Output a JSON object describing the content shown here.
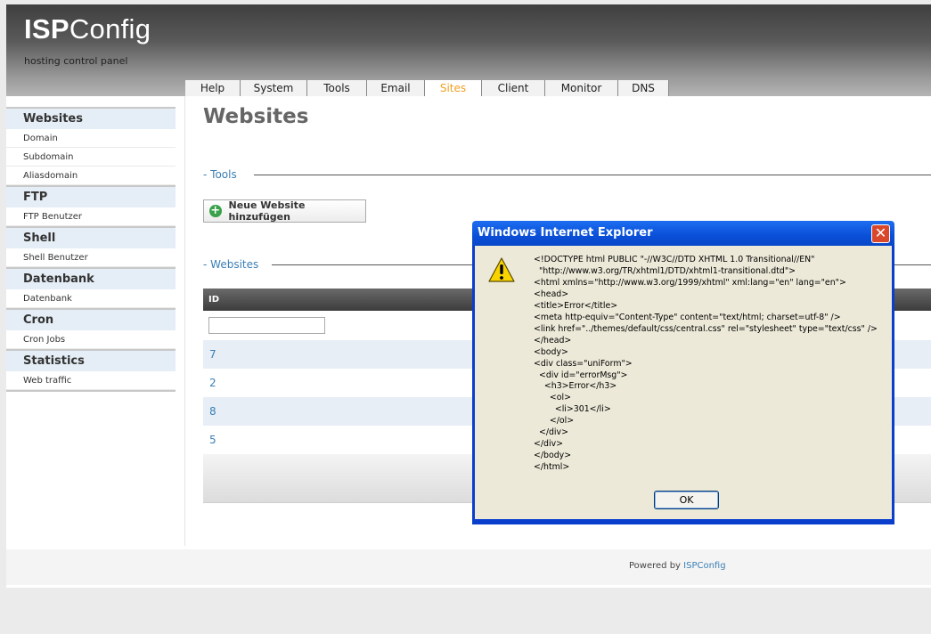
{
  "header": {
    "logo_isp": "ISP",
    "logo_config": "Config",
    "tagline": "hosting control panel",
    "tabs": [
      {
        "label": "Help"
      },
      {
        "label": "System"
      },
      {
        "label": "Tools"
      },
      {
        "label": "Email"
      },
      {
        "label": "Sites",
        "active": true
      },
      {
        "label": "Client"
      },
      {
        "label": "Monitor"
      },
      {
        "label": "DNS"
      }
    ]
  },
  "sidebar": {
    "groups": [
      {
        "title": "Websites",
        "items": [
          "Domain",
          "Subdomain",
          "Aliasdomain"
        ]
      },
      {
        "title": "FTP",
        "items": [
          "FTP Benutzer"
        ]
      },
      {
        "title": "Shell",
        "items": [
          "Shell Benutzer"
        ]
      },
      {
        "title": "Datenbank",
        "items": [
          "Datenbank"
        ]
      },
      {
        "title": "Cron",
        "items": [
          "Cron Jobs"
        ]
      },
      {
        "title": "Statistics",
        "items": [
          "Web traffic"
        ]
      }
    ]
  },
  "main": {
    "title": "Websites",
    "tools_legend": "Tools",
    "add_button": "Neue Website hinzufügen",
    "websites_legend": "Websites",
    "table": {
      "header_id": "ID",
      "filter_value": "",
      "rows": [
        "7",
        "2",
        "8",
        "5"
      ]
    }
  },
  "footer": {
    "text": "Powered by",
    "link": "ISPConfig"
  },
  "dialog": {
    "title": "Windows Internet Explorer",
    "message": "<!DOCTYPE html PUBLIC \"-//W3C//DTD XHTML 1.0 Transitional//EN\"\n  \"http://www.w3.org/TR/xhtml1/DTD/xhtml1-transitional.dtd\">\n<html xmlns=\"http://www.w3.org/1999/xhtml\" xml:lang=\"en\" lang=\"en\">\n<head>\n<title>Error</title>\n<meta http-equiv=\"Content-Type\" content=\"text/html; charset=utf-8\" />\n<link href=\"../themes/default/css/central.css\" rel=\"stylesheet\" type=\"text/css\" />\n</head>\n<body>\n<div class=\"uniForm\">\n  <div id=\"errorMsg\">\n    <h3>Error</h3>\n      <ol>\n        <li>301</li>\n      </ol>\n  </div>\n</div>\n</body>\n</html>",
    "ok_label": "OK",
    "close_glyph": "✕"
  },
  "colors": {
    "accent_tab": "#f0a020",
    "link": "#3a7fb5",
    "dialog_title": "#0a4fd8"
  },
  "icons": [
    "plus-icon",
    "warning-icon",
    "close-icon"
  ]
}
